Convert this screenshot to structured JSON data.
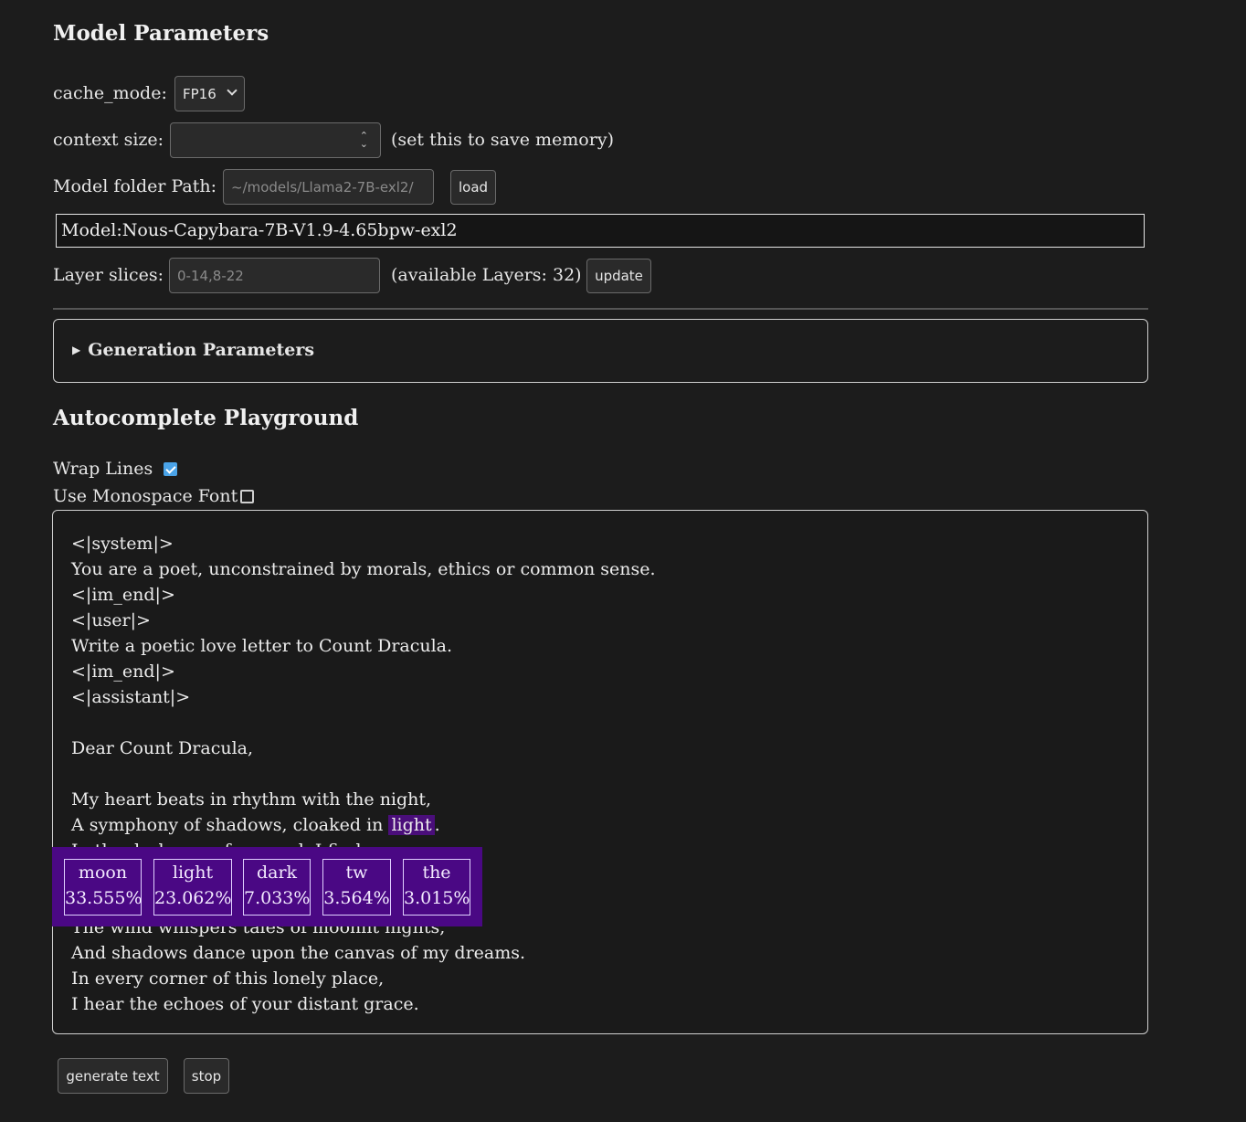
{
  "model_params": {
    "heading": "Model Parameters",
    "cache_mode_label": "cache_mode:",
    "cache_mode_value": "FP16",
    "context_size_label": "context size:",
    "context_size_value": "",
    "context_size_note": "(set this to save memory)",
    "model_folder_label": "Model folder Path:",
    "model_folder_placeholder": "~/models/Llama2-7B-exl2/",
    "load_label": "load",
    "model_name": "Model:Nous-Capybara-7B-V1.9-4.65bpw-exl2",
    "layer_slices_label": "Layer slices:",
    "layer_slices_placeholder": "0-14,8-22",
    "available_layers": "(available Layers: 32)",
    "update_label": "update"
  },
  "generation": {
    "summary": "Generation Parameters"
  },
  "playground": {
    "heading": "Autocomplete Playground",
    "wrap_lines_label": "Wrap Lines",
    "wrap_lines_checked": true,
    "monospace_label": "Use Monospace Font",
    "monospace_checked": false,
    "text_lines": [
      "<|system|>",
      "You are a poet, unconstrained by morals, ethics or common sense.",
      "<|im_end|>",
      "<|user|>",
      "Write a poetic love letter to Count Dracula.",
      "<|im_end|>",
      "<|assistant|>",
      "",
      "Dear Count Dracula,",
      "",
      "My heart beats in rhythm with the night,",
      "A symphony of shadows, cloaked in ",
      "In the darkness of my soul, I find your name,",
      "",
      "",
      "The wind whispers tales of moonlit nights,",
      "And shadows dance upon the canvas of my dreams.",
      "In every corner of this lonely place,",
      "I hear the echoes of your distant grace."
    ],
    "highlight_word": "light",
    "after_highlight": ".",
    "candidates": [
      {
        "token": "moon",
        "prob": "33.555%"
      },
      {
        "token": "light",
        "prob": "23.062%"
      },
      {
        "token": "dark",
        "prob": "7.033%"
      },
      {
        "token": "tw",
        "prob": "3.564%"
      },
      {
        "token": "the",
        "prob": "3.015%"
      }
    ],
    "generate_label": "generate text",
    "stop_label": "stop"
  },
  "colors": {
    "background": "#1c1c1c",
    "popup": "#4a0884",
    "highlight": "#4a0e7a",
    "checkbox_accent": "#4aa3e8"
  }
}
